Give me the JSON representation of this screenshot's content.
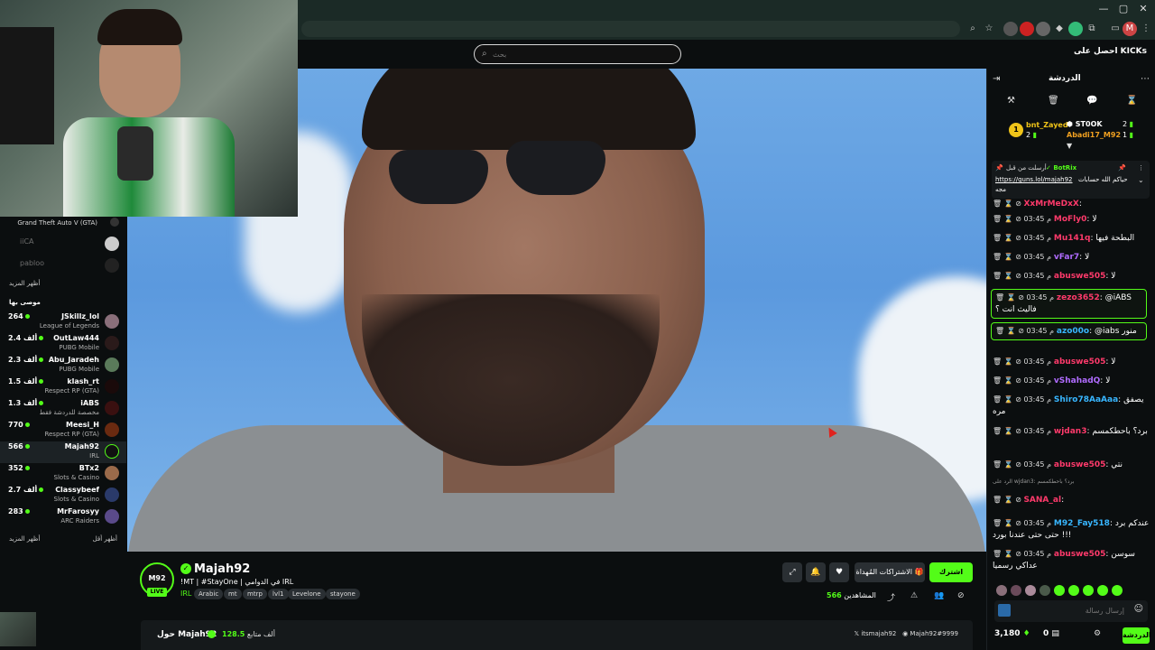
{
  "browser": {
    "window_controls": [
      "—",
      "▢",
      "✕"
    ]
  },
  "topnav": {
    "search_placeholder": "بحث",
    "get_kicks": "احصل على KICKs"
  },
  "sidebar": {
    "top_category": "Grand Theft Auto V (GTA)",
    "following": [
      {
        "name": "iiCA"
      },
      {
        "name": "pabloo"
      }
    ],
    "show_more_1": "أظهر المزيد",
    "recommended_heading": "موصى بها",
    "recommended": [
      {
        "name": "JSkillz_lol",
        "sub": "League of Legends",
        "count": "264"
      },
      {
        "name": "OutLaw444",
        "sub": "PUBG Mobile",
        "count": "2.4 ألف"
      },
      {
        "name": "Abu_Jaradeh",
        "sub": "PUBG Mobile",
        "count": "2.3 ألف"
      },
      {
        "name": "klash_rt",
        "sub": "Respect RP (GTA)",
        "count": "1.5 ألف"
      },
      {
        "name": "iABS",
        "sub": "مخصصة للدردشة فقط",
        "count": "1.3 ألف"
      },
      {
        "name": "Meesi_H",
        "sub": "Respect RP (GTA)",
        "count": "770"
      },
      {
        "name": "Majah92",
        "sub": "IRL",
        "count": "566",
        "active": true
      },
      {
        "name": "BTx2",
        "sub": "Slots & Casino",
        "count": "352"
      },
      {
        "name": "Classybeef",
        "sub": "Slots & Casino",
        "count": "2.7 ألف"
      },
      {
        "name": "MrFarosyy",
        "sub": "ARC Raiders",
        "count": "283"
      }
    ],
    "show_more_2": "أظهر المزيد",
    "show_less": "أظهر أقل"
  },
  "stream": {
    "streamer_avatar_text": "M92",
    "live": "LIVE",
    "name": "Majah92",
    "title": "!MT | #StayOne | في الدوامي IRL",
    "category": "IRL",
    "tags": [
      "Arabic",
      "mt",
      "mtrp",
      "lvl1",
      "Levelone",
      "stayone"
    ],
    "subscribe": "اشترك",
    "gift_subs": "الاشتراكات المُهداة",
    "viewers_count": "566",
    "viewers_label": "المشاهدين",
    "about_name": "حول Majah92",
    "followers_count": "128.5",
    "followers_label": "ألف متابع",
    "social_x": "itsmajah92",
    "social_discord": "Majah92#9999"
  },
  "chat": {
    "title": "الدردشة",
    "leaderboard": [
      {
        "rank": "1",
        "name": "bnt_Zayed",
        "value": "2"
      },
      {
        "name": "ST0OK",
        "value": "2"
      },
      {
        "name": "Abadi17_M92",
        "value": "1"
      }
    ],
    "pinned": {
      "author": "BotRix",
      "pinned_by": "أرسلت من قبل",
      "link": "https://guns.lol/majah92",
      "text": "حياكم الله حسابات",
      "extra": "مجه"
    },
    "messages": [
      {
        "user": "XxMrMeDxX",
        "color": "#ff3a6b",
        "text": ""
      },
      {
        "time": "03:45 م",
        "user": "MoFly0",
        "color": "#ff3a6b",
        "text": "لا"
      },
      {
        "time": "03:45 م",
        "user": "Mu141q",
        "color": "#ff3a6b",
        "text": "البطحة فيها"
      },
      {
        "time": "03:45 م",
        "user": "vFar7",
        "color": "#b06cff",
        "text": "لا"
      },
      {
        "time": "03:45 م",
        "user": "abuswe505",
        "color": "#ff3a6b",
        "text": "لا"
      },
      {
        "time": "03:45 م",
        "user": "zezo3652",
        "color": "#ff3a6b",
        "text": "@iABS فاليث انت ؟",
        "highlight": true
      },
      {
        "time": "03:45 م",
        "user": "azo00o",
        "color": "#38b6ff",
        "text": "@iabs منور",
        "highlight": true
      },
      {
        "time": "03:45 م",
        "user": "abuswe505",
        "color": "#ff3a6b",
        "text": "لا"
      },
      {
        "time": "03:45 م",
        "user": "vShahadQ",
        "color": "#b06cff",
        "text": "لا"
      },
      {
        "time": "03:45 م",
        "user": "Shiro78AaAaa",
        "color": "#38b6ff",
        "text": "يصفق مره"
      },
      {
        "time": "03:45 م",
        "user": "wjdan3",
        "color": "#ff3a6b",
        "text": "برد؟ باحطكمسم"
      },
      {
        "time": "03:45 م",
        "user": "abuswe505",
        "color": "#ff3a6b",
        "text": "نتي"
      },
      {
        "reply": "الرد على wjdan3: برد؟ باحطكمسم"
      },
      {
        "user": "SANA_al",
        "color": "#ff3a6b",
        "text": ""
      },
      {
        "time": "03:45 م",
        "user": "M92_Fay518",
        "color": "#38b6ff",
        "text": "عندكم برد حتى حتى عندنا بورد !!!"
      },
      {
        "time": "03:45 م",
        "user": "abuswe505",
        "color": "#ff3a6b",
        "text": "سوسن عداكي رسميا"
      }
    ],
    "input_placeholder": "إرسال رسالة",
    "points": "3,180",
    "count": "0",
    "send": "الدردشة"
  }
}
